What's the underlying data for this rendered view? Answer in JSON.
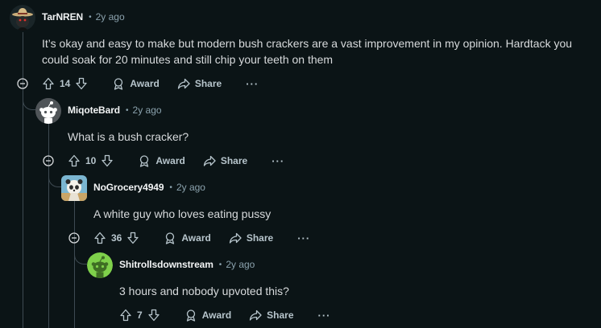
{
  "comments": [
    {
      "username": "TarNREN",
      "time": "2y ago",
      "body_lines": [
        "It’s okay and easy to make but modern bush crackers are a vast improvement in my opinion. Hardtack you",
        "could soak for 20 minutes and still chip your teeth on them"
      ],
      "votes": "14",
      "award_label": "Award",
      "share_label": "Share",
      "more_label": "···",
      "avatar_icon": "cowboy-avatar-icon"
    },
    {
      "username": "MiqoteBard",
      "time": "2y ago",
      "body_lines": [
        "What is a bush cracker?"
      ],
      "votes": "10",
      "award_label": "Award",
      "share_label": "Share",
      "more_label": "···",
      "avatar_icon": "snoo-avatar-icon"
    },
    {
      "username": "NoGrocery4949",
      "time": "2y ago",
      "body_lines": [
        "A white guy who loves eating pussy"
      ],
      "votes": "36",
      "award_label": "Award",
      "share_label": "Share",
      "more_label": "···",
      "avatar_icon": "panda-avatar-icon"
    },
    {
      "username": "Shitrollsdownstream",
      "time": "2y ago",
      "body_lines": [
        "3 hours and nobody upvoted this?"
      ],
      "votes": "7",
      "award_label": "Award",
      "share_label": "Share",
      "more_label": "···",
      "avatar_icon": "green-snoo-avatar-icon"
    }
  ],
  "separator": "•",
  "colors": {
    "background": "#0b1416",
    "thread_line": "#3e4a52",
    "meta_text": "#8ba2ad",
    "action_text": "#b7c5cc",
    "green_avatar": "#7fd14b",
    "panda_avatar_bg": "#7bb6d1"
  }
}
